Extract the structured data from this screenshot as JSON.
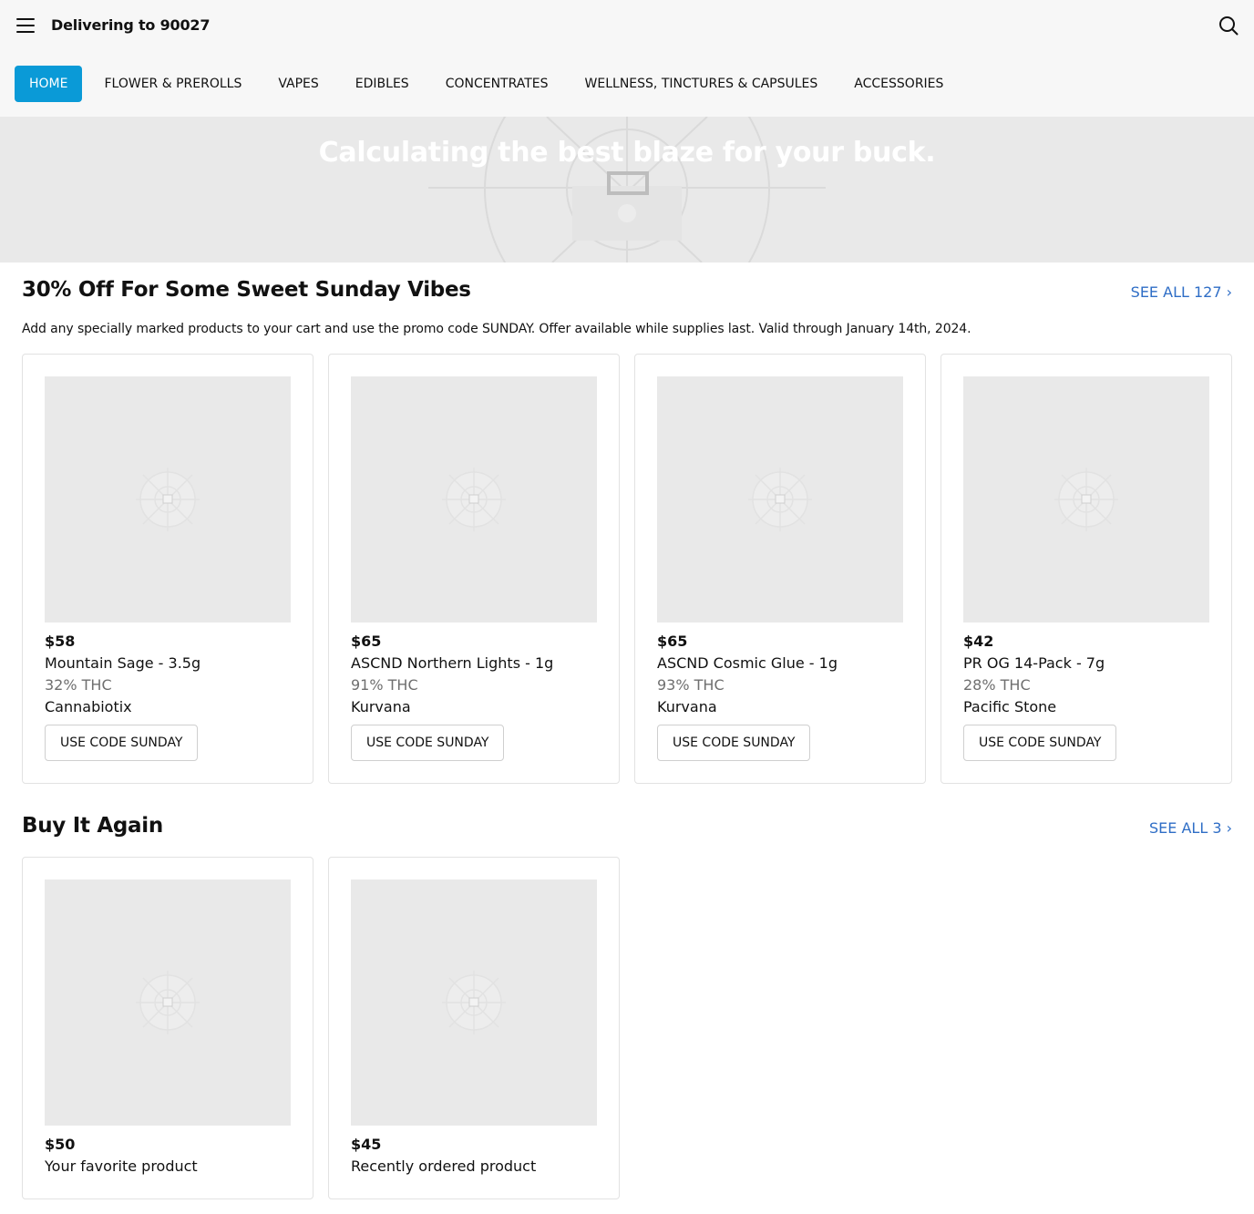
{
  "header": {
    "delivering_label": "Delivering to 90027",
    "menu_icon": "hamburger-menu-icon",
    "search_icon": "search-icon"
  },
  "nav": {
    "tabs": [
      {
        "label": "HOME",
        "active": true
      },
      {
        "label": "FLOWER & PREROLLS",
        "active": false
      },
      {
        "label": "VAPES",
        "active": false
      },
      {
        "label": "EDIBLES",
        "active": false
      },
      {
        "label": "CONCENTRATES",
        "active": false
      },
      {
        "label": "WELLNESS, TINCTURES & CAPSULES",
        "active": false
      },
      {
        "label": "ACCESSORIES",
        "active": false
      }
    ],
    "active_color": "#0a9ad7"
  },
  "hero": {
    "title": "Calculating the best blaze for your buck."
  },
  "promo_section": {
    "title": "30% Off For Some Sweet Sunday Vibes",
    "see_all": "SEE ALL 127 ›",
    "description": "Add any specially marked products to your cart and use the promo code SUNDAY. Offer available while supplies last. Valid through January 14th, 2024.",
    "products": [
      {
        "price": "$58",
        "name": "Mountain Sage - 3.5g",
        "thc": "32% THC",
        "brand": "Cannabiotix",
        "button": "USE CODE SUNDAY"
      },
      {
        "price": "$65",
        "name": "ASCND Northern Lights - 1g",
        "thc": "91% THC",
        "brand": "Kurvana",
        "button": "USE CODE SUNDAY"
      },
      {
        "price": "$65",
        "name": "ASCND Cosmic Glue - 1g",
        "thc": "93% THC",
        "brand": "Kurvana",
        "button": "USE CODE SUNDAY"
      },
      {
        "price": "$42",
        "name": "PR OG 14-Pack - 7g",
        "thc": "28% THC",
        "brand": "Pacific Stone",
        "button": "USE CODE SUNDAY"
      }
    ]
  },
  "buy_again_section": {
    "title": "Buy It Again",
    "see_all": "SEE ALL 3 ›",
    "products": [
      {
        "price": "$50",
        "name": "Your favorite product"
      },
      {
        "price": "$45",
        "name": "Recently ordered product"
      }
    ]
  },
  "colors": {
    "link": "#2f6ec6",
    "placeholder": "#e9e9e9"
  }
}
